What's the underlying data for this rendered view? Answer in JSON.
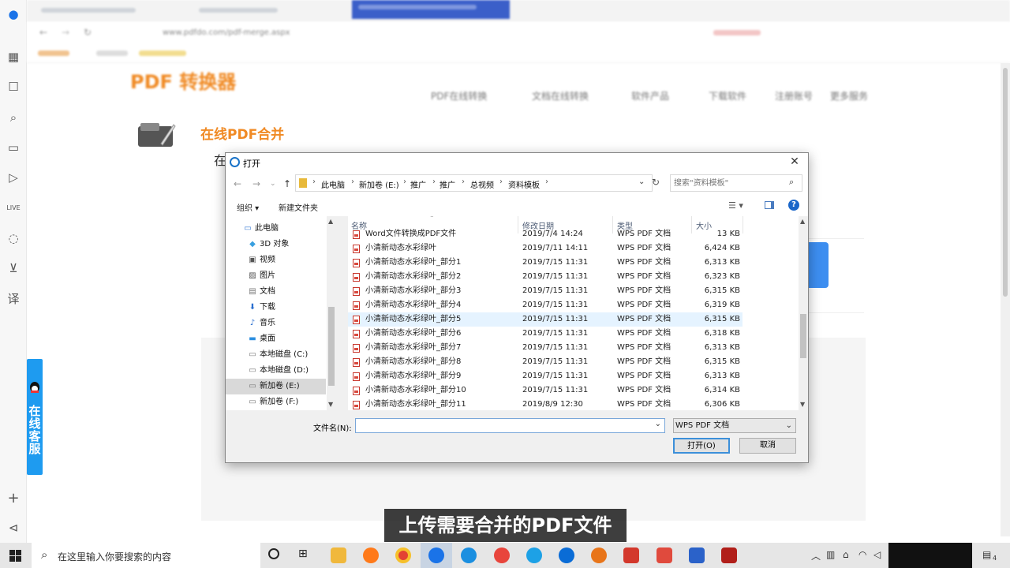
{
  "browser": {
    "tabs": [
      "",
      ""
    ],
    "address": "www.pdfdo.com/pdf-merge.aspx",
    "site_logo": "PDF 转换器",
    "site_nav": [
      "PDF在线转换",
      "文档在线转换",
      "软件产品",
      "下载软件",
      "注册账号",
      "更多服务"
    ],
    "page_title": "在线PDF合并",
    "page_text": "在",
    "qq_service": "在线客服"
  },
  "dialog": {
    "title": "打开",
    "breadcrumb": [
      "此电脑",
      "新加卷 (E:)",
      "推广",
      "推广",
      "总视频",
      "资料模板"
    ],
    "search_placeholder": "搜索\"资料模板\"",
    "organize_label": "组织 ▾",
    "new_folder_label": "新建文件夹",
    "tree": [
      {
        "label": "此电脑",
        "icon": "pc-icon"
      },
      {
        "label": "3D 对象",
        "icon": "3d-objects-icon"
      },
      {
        "label": "视频",
        "icon": "video-icon"
      },
      {
        "label": "图片",
        "icon": "pictures-icon"
      },
      {
        "label": "文档",
        "icon": "documents-icon"
      },
      {
        "label": "下载",
        "icon": "download-icon"
      },
      {
        "label": "音乐",
        "icon": "music-icon"
      },
      {
        "label": "桌面",
        "icon": "desktop-icon"
      },
      {
        "label": "本地磁盘 (C:)",
        "icon": "drive-icon"
      },
      {
        "label": "本地磁盘 (D:)",
        "icon": "drive-icon"
      },
      {
        "label": "新加卷 (E:)",
        "icon": "drive-icon",
        "selected": true
      },
      {
        "label": "新加卷 (F:)",
        "icon": "drive-icon"
      }
    ],
    "columns": [
      "名称",
      "修改日期",
      "类型",
      "大小"
    ],
    "files": [
      {
        "name": "Word文件转换成PDF文件",
        "date": "2019/7/4 14:24",
        "type": "WPS PDF 文档",
        "size": "13 KB"
      },
      {
        "name": "小清新动态水彩绿叶",
        "date": "2019/7/11 14:11",
        "type": "WPS PDF 文档",
        "size": "6,424 KB"
      },
      {
        "name": "小清新动态水彩绿叶_部分1",
        "date": "2019/7/15 11:31",
        "type": "WPS PDF 文档",
        "size": "6,313 KB"
      },
      {
        "name": "小清新动态水彩绿叶_部分2",
        "date": "2019/7/15 11:31",
        "type": "WPS PDF 文档",
        "size": "6,323 KB"
      },
      {
        "name": "小清新动态水彩绿叶_部分3",
        "date": "2019/7/15 11:31",
        "type": "WPS PDF 文档",
        "size": "6,315 KB"
      },
      {
        "name": "小清新动态水彩绿叶_部分4",
        "date": "2019/7/15 11:31",
        "type": "WPS PDF 文档",
        "size": "6,319 KB"
      },
      {
        "name": "小清新动态水彩绿叶_部分5",
        "date": "2019/7/15 11:31",
        "type": "WPS PDF 文档",
        "size": "6,315 KB",
        "hover": true
      },
      {
        "name": "小清新动态水彩绿叶_部分6",
        "date": "2019/7/15 11:31",
        "type": "WPS PDF 文档",
        "size": "6,318 KB"
      },
      {
        "name": "小清新动态水彩绿叶_部分7",
        "date": "2019/7/15 11:31",
        "type": "WPS PDF 文档",
        "size": "6,313 KB"
      },
      {
        "name": "小清新动态水彩绿叶_部分8",
        "date": "2019/7/15 11:31",
        "type": "WPS PDF 文档",
        "size": "6,315 KB"
      },
      {
        "name": "小清新动态水彩绿叶_部分9",
        "date": "2019/7/15 11:31",
        "type": "WPS PDF 文档",
        "size": "6,313 KB"
      },
      {
        "name": "小清新动态水彩绿叶_部分10",
        "date": "2019/7/15 11:31",
        "type": "WPS PDF 文档",
        "size": "6,314 KB"
      },
      {
        "name": "小清新动态水彩绿叶_部分11",
        "date": "2019/8/9 12:30",
        "type": "WPS PDF 文档",
        "size": "6,306 KB"
      }
    ],
    "filename_label": "文件名(N):",
    "filename_value": "",
    "filetype": "WPS PDF 文档",
    "open_label": "打开(O)",
    "cancel_label": "取消"
  },
  "caption": "上传需要合并的PDF文件",
  "taskbar": {
    "search_text": "在这里输入你要搜索的内容",
    "notification_count": "4"
  },
  "colors": {
    "accent_orange": "#f08a24",
    "qq_blue": "#1e9bf0",
    "win_blue": "#0078d7",
    "pdf_red": "#c8362c"
  }
}
